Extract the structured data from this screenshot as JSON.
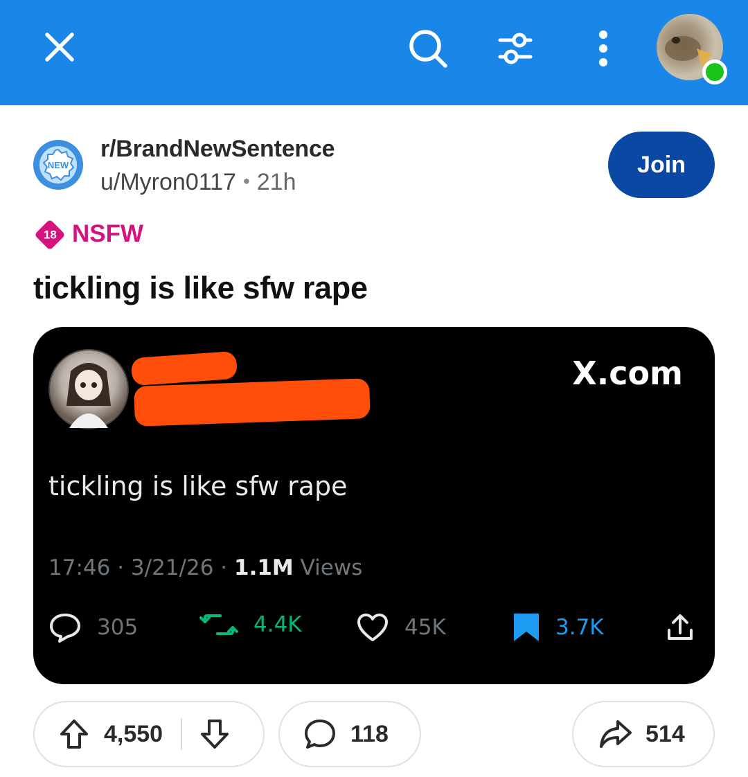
{
  "topbar": {
    "close_icon": "close-icon",
    "search_icon": "search-icon",
    "filter_icon": "sort-filter-icon",
    "more_icon": "more-vertical-icon",
    "avatar_online": true,
    "color": "#1a87e8"
  },
  "post": {
    "subreddit": "r/BrandNewSentence",
    "subreddit_icon_text": "NEW",
    "author": "u/Myron0117",
    "separator": "•",
    "age": "21h",
    "join_label": "Join",
    "nsfw_badge": "18",
    "nsfw_label": "NSFW",
    "title": "tickling is like sfw rape"
  },
  "embed": {
    "source": "X.com",
    "text": "tickling is like sfw rape",
    "time": "17:46",
    "date": "3/21/26",
    "dot": "·",
    "views_count": "1.1M",
    "views_label": "Views",
    "replies": "305",
    "reposts": "4.4K",
    "likes": "45K",
    "bookmarks": "3.7K",
    "redaction_color": "#ff4e0a"
  },
  "actions": {
    "upvotes": "4,550",
    "comments": "118",
    "shares": "514"
  }
}
